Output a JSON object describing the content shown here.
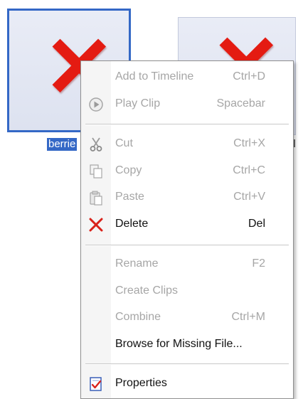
{
  "clips": {
    "selected_label": "berrie",
    "other_label": "al"
  },
  "menu": {
    "items": [
      {
        "label": "Add to Timeline",
        "shortcut": "Ctrl+D",
        "enabled": false,
        "icon": "none"
      },
      {
        "label": "Play Clip",
        "shortcut": "Spacebar",
        "enabled": false,
        "icon": "play-icon"
      },
      {
        "label": "Cut",
        "shortcut": "Ctrl+X",
        "enabled": false,
        "icon": "scissors-icon"
      },
      {
        "label": "Copy",
        "shortcut": "Ctrl+C",
        "enabled": false,
        "icon": "copy-icon"
      },
      {
        "label": "Paste",
        "shortcut": "Ctrl+V",
        "enabled": false,
        "icon": "paste-icon"
      },
      {
        "label": "Delete",
        "shortcut": "Del",
        "enabled": true,
        "icon": "delete-x-icon"
      },
      {
        "label": "Rename",
        "shortcut": "F2",
        "enabled": false,
        "icon": "none"
      },
      {
        "label": "Create Clips",
        "shortcut": "",
        "enabled": false,
        "icon": "none"
      },
      {
        "label": "Combine",
        "shortcut": "Ctrl+M",
        "enabled": false,
        "icon": "none"
      },
      {
        "label": "Browse for Missing File...",
        "shortcut": "",
        "enabled": true,
        "icon": "none"
      },
      {
        "label": "Properties",
        "shortcut": "",
        "enabled": true,
        "icon": "properties-icon"
      }
    ]
  },
  "colors": {
    "selection": "#3468c6",
    "missing_x": "#e41b12",
    "disabled_text": "#a6a6a6"
  }
}
